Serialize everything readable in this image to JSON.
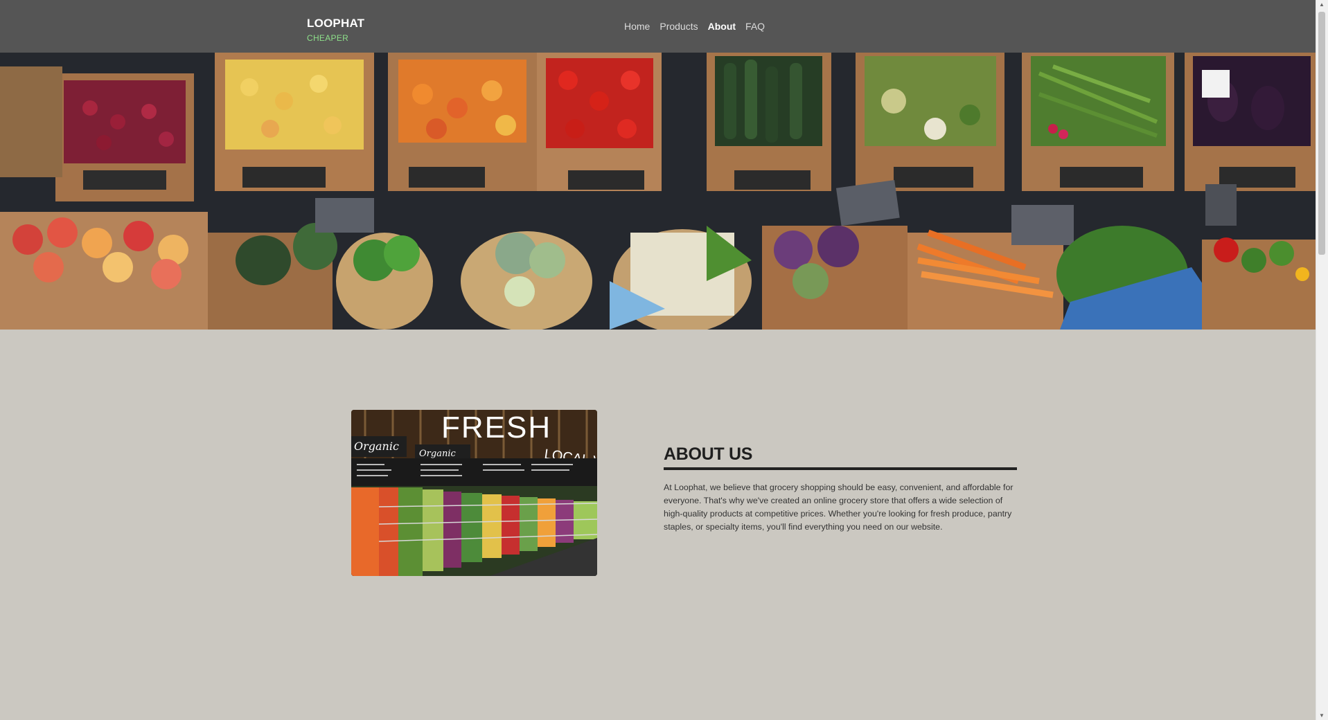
{
  "header": {
    "brand_name": "LOOPHAT",
    "brand_tagline": "CHEAPER",
    "nav": [
      {
        "label": "Home",
        "active": false
      },
      {
        "label": "Products",
        "active": false
      },
      {
        "label": "About",
        "active": true
      },
      {
        "label": "FAQ",
        "active": false
      }
    ]
  },
  "hero": {
    "image": "produce crates with fruits and vegetables"
  },
  "about": {
    "image": "grocery store produce aisle",
    "image_signs": [
      "FRESH",
      "LOCAL VALUE",
      "Organic",
      "Organic"
    ],
    "title": "ABOUT US",
    "body": "At Loophat, we believe that grocery shopping should be easy, convenient, and affordable for everyone. That's why we've created an online grocery store that offers a wide selection of high-quality products at competitive prices. Whether you're looking for fresh produce, pantry staples, or specialty items, you'll find everything you need on our website."
  },
  "colors": {
    "navbar": "#555555",
    "page_background": "#cbc8c1",
    "tagline": "#8ee08a"
  }
}
